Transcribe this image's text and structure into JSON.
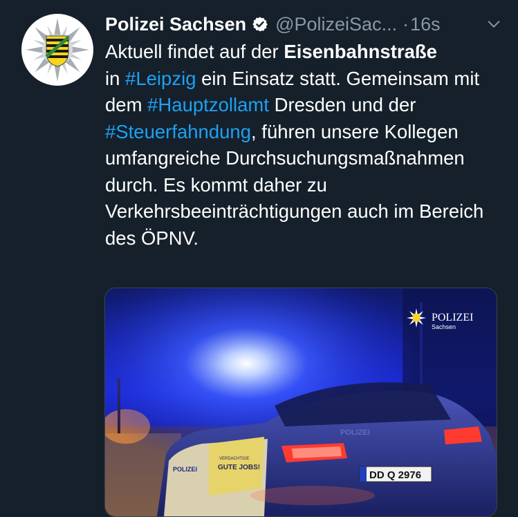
{
  "account": {
    "display_name": "Polizei Sachsen",
    "handle": "@PolizeiSac...",
    "separator": "·",
    "time": "16s"
  },
  "tweet": {
    "line1_plain_a": "Aktuell findet auf der ",
    "line1_bold": "Eisenbahnstraße",
    "line2_plain_a": "in ",
    "hashtag_leipzig": "#Leipzig",
    "line2_plain_b": " ein Einsatz statt. Gemeinsam mit dem ",
    "hashtag_hauptzollamt": "#Hauptzollamt",
    "line3_plain": " Dresden und der ",
    "hashtag_steuerfahndung": "#Steuerfahndung",
    "rest": ", führen unsere Kollegen umfangreiche Durchsuchungsmaßnahmen durch. Es kommt daher zu Verkehrsbeeinträchtigungen auch im Bereich des ÖPNV."
  },
  "media": {
    "watermark_title": "POLIZEI",
    "watermark_sub": "Sachsen",
    "plate": "DD Q 2976",
    "car_text_1": "VERDACHTIGE",
    "car_text_2": "GUTE JOBS!",
    "car_text_side": "POLIZEI",
    "car_text_rear": "POLIZEI"
  },
  "colors": {
    "background": "#15202b",
    "link": "#1da1f2",
    "muted": "#8899a6"
  },
  "icons": {
    "avatar": "polizei-star-crest-icon",
    "verified": "verified-badge-icon",
    "menu": "chevron-down-icon"
  }
}
